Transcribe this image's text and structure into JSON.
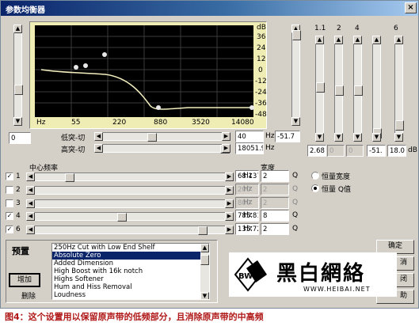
{
  "window": {
    "title": "参数均衡器",
    "close_glyph": "×"
  },
  "graph": {
    "db_labels": [
      "dB",
      "36",
      "24",
      "12",
      "0",
      "-12",
      "-24",
      "-36",
      "-48"
    ],
    "freq_labels": [
      "Hz",
      "55",
      "220",
      "880",
      "3520",
      "14080"
    ]
  },
  "band_columns": {
    "headers": [
      "1.1",
      "2",
      "4",
      "6"
    ],
    "values": [
      "2.68",
      "0",
      "0",
      "-51.",
      "18.0",
      "dB"
    ]
  },
  "main_gain": {
    "value": "0"
  },
  "cuts": {
    "low_label": "低突-切",
    "low_value": "40",
    "low_unit": "Hz",
    "low_db": "-51.7",
    "high_label": "高突-切",
    "high_value": "18051.9",
    "high_unit": "Hz"
  },
  "bands": {
    "center_freq_label": "中心频率",
    "width_label": "宽度",
    "rows": [
      {
        "id": "1",
        "checked": true,
        "freq": "68.1374",
        "unit": "Hz",
        "width": "2",
        "wunit": "Q"
      },
      {
        "id": "2",
        "checked": false,
        "freq": "200",
        "unit": "Hz",
        "width": "2",
        "wunit": "Q"
      },
      {
        "id": "3",
        "checked": false,
        "freq": "800",
        "unit": "Hz",
        "width": "2",
        "wunit": "Q"
      },
      {
        "id": "4",
        "checked": true,
        "freq": "785.811",
        "unit": "Hz",
        "width": "8",
        "wunit": "Q"
      },
      {
        "id": "6",
        "checked": true,
        "freq": "135.724",
        "unit": "Hz",
        "width": "2",
        "wunit": "Q"
      }
    ]
  },
  "width_mode": {
    "option1": "恒量宽度",
    "option2": "恒量 Q值"
  },
  "presets": {
    "label": "预置",
    "add_button": "增加",
    "delete_button": "删除",
    "items": [
      "250Hz Cut with Low End Shelf",
      "Absolute Zero",
      "Added Dimension",
      "High Boost with 16k notch",
      "Highs Softener",
      "Hum and Hiss Removal",
      "Loudness"
    ],
    "selected_index": 1
  },
  "buttons": {
    "ok": "确定",
    "cancel": "消",
    "close": "闭",
    "help": "助"
  },
  "watermark": {
    "text": "黑白網絡",
    "url": "WWW.HEIBAI.NET",
    "badge": "BW"
  },
  "caption": "图4：这个设置用以保留原声带的低频部分，且消除原声带的中高频"
}
